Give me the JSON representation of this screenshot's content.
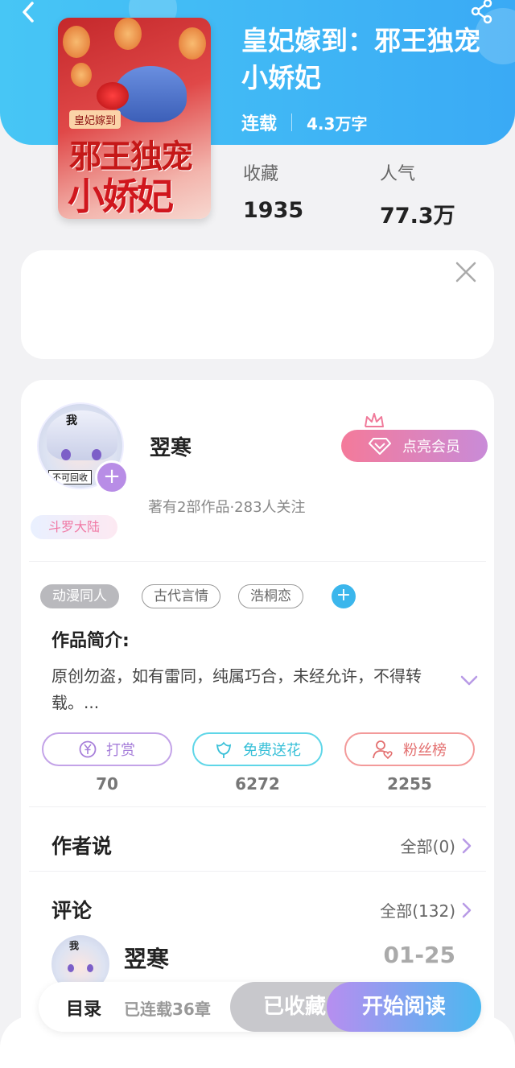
{
  "book": {
    "title": "皇妃嫁到：邪王独宠小娇妃",
    "status": "连载",
    "word_count": "4.3万字",
    "cover_text_top": "皇妃嫁到",
    "cover_text_main1": "邪王独宠",
    "cover_text_main2": "小娇妃"
  },
  "stats": {
    "favorites_label": "收藏",
    "favorites_value": "1935",
    "popularity_label": "人气",
    "popularity_value": "77.3万"
  },
  "author": {
    "name": "翌寒",
    "stats": "著有2部作品·283人关注",
    "badge": "斗罗大陆",
    "avatar_text": "我",
    "avatar_sign": "不可回收",
    "vip_button": "点亮会员"
  },
  "tags": [
    "动漫同人",
    "古代言情",
    "浩桐恋"
  ],
  "intro": {
    "title": "作品简介:",
    "text": "原创勿盗，如有雷同，纯属巧合，未经允许，不得转载。..."
  },
  "actions": [
    {
      "label": "打赏",
      "count": "70"
    },
    {
      "label": "免费送花",
      "count": "6272"
    },
    {
      "label": "粉丝榜",
      "count": "2255"
    }
  ],
  "author_says": {
    "title": "作者说",
    "link": "全部(0)"
  },
  "comments": {
    "title": "评论",
    "link": "全部(132)",
    "first": {
      "name": "翌寒",
      "date": "01-25",
      "avatar_text": "我"
    }
  },
  "bottom_bar": {
    "toc": "目录",
    "chapter_count": "已连载36章",
    "favorited": "已收藏",
    "read": "开始阅读"
  },
  "colors": {
    "header": "#3aaaf5",
    "accent_purple": "#b88de6",
    "accent_cyan": "#38c0d8",
    "accent_red": "#e36f6f"
  }
}
